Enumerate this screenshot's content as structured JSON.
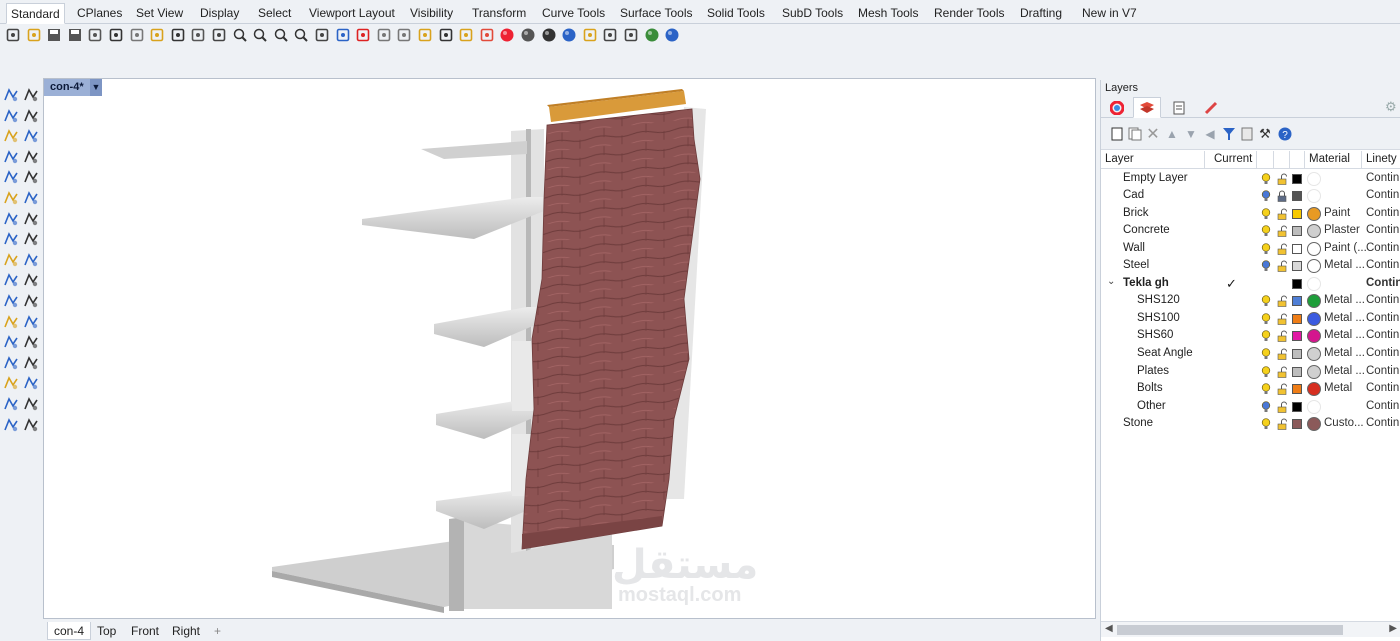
{
  "menu_tabs": [
    {
      "label": "Standard",
      "active": true
    },
    {
      "label": "CPlanes"
    },
    {
      "label": "Set View"
    },
    {
      "label": "Display"
    },
    {
      "label": "Select"
    },
    {
      "label": "Viewport Layout"
    },
    {
      "label": "Visibility"
    },
    {
      "label": "Transform"
    },
    {
      "label": "Curve Tools"
    },
    {
      "label": "Surface Tools"
    },
    {
      "label": "Solid Tools"
    },
    {
      "label": "SubD Tools"
    },
    {
      "label": "Mesh Tools"
    },
    {
      "label": "Render Tools"
    },
    {
      "label": "Drafting"
    },
    {
      "label": "New in V7"
    }
  ],
  "toolbar_icons": [
    "new-icon",
    "open-icon",
    "save-icon",
    "print-icon",
    "import-icon",
    "cut-icon",
    "copy-icon",
    "paste-icon",
    "undo-icon",
    "pan-icon",
    "move-view-icon",
    "zoom-icon",
    "zoom-window-icon",
    "zoom-extents-icon",
    "zoom-selected-icon",
    "rotate-view-icon",
    "viewport-layout-icon",
    "car-icon",
    "hide-icon",
    "select-icon",
    "show-icon",
    "light-icon",
    "lock-icon",
    "layer-icon",
    "color-icon",
    "shade-icon",
    "render-icon",
    "sphere-icon",
    "properties-icon",
    "options-icon",
    "grid-snap-icon",
    "globe-icon",
    "help-icon"
  ],
  "viewport": {
    "title": "con-4*",
    "tabs": [
      {
        "label": "con-4",
        "active": true
      },
      {
        "label": "Top"
      },
      {
        "label": "Front"
      },
      {
        "label": "Right"
      },
      {
        "label": "+"
      }
    ]
  },
  "watermark": {
    "arabic": "مستقل",
    "latin": "mostaql.com"
  },
  "layers_panel": {
    "title": "Layers",
    "columns": {
      "layer": "Layer",
      "current": "Current",
      "material": "Material",
      "linetype": "Linety"
    },
    "rows": [
      {
        "name": "Empty Layer",
        "indent": 0,
        "bulb": "#f5d11c",
        "lock": "open",
        "color": "#000000",
        "material": "",
        "mat_color": "",
        "linetype": "Contin"
      },
      {
        "name": "Cad",
        "indent": 0,
        "bulb": "#4a78d6",
        "lock": "closed",
        "color": "#555555",
        "material": "",
        "mat_color": "",
        "linetype": "Contin"
      },
      {
        "name": "Brick",
        "indent": 0,
        "bulb": "#f5d11c",
        "lock": "open",
        "color": "#f7c900",
        "material": "Paint",
        "mat_color": "#e89a23",
        "linetype": "Contin"
      },
      {
        "name": "Concrete",
        "indent": 0,
        "bulb": "#f5d11c",
        "lock": "open",
        "color": "#bdbdbd",
        "material": "Plaster",
        "mat_color": "#cfcfcf",
        "linetype": "Contin"
      },
      {
        "name": "Wall",
        "indent": 0,
        "bulb": "#f5d11c",
        "lock": "open",
        "color": "#ffffff",
        "material": "Paint (...",
        "mat_color": "#ffffff",
        "linetype": "Contin"
      },
      {
        "name": "Steel",
        "indent": 0,
        "bulb": "#4a78d6",
        "lock": "open",
        "color": "#d9d9d9",
        "material": "Metal ...",
        "mat_color": "#ffffff",
        "linetype": "Contin"
      },
      {
        "name": "Tekla gh",
        "indent": 0,
        "bold": true,
        "toggle": "⌄",
        "current": "✓",
        "color": "#000000",
        "material": "",
        "mat_color": "",
        "linetype": "Contin"
      },
      {
        "name": "SHS120",
        "indent": 1,
        "bulb": "#f5d11c",
        "lock": "open",
        "color": "#4f7fd6",
        "material": "Metal ...",
        "mat_color": "#1e9e3a",
        "linetype": "Contin"
      },
      {
        "name": "SHS100",
        "indent": 1,
        "bulb": "#f5d11c",
        "lock": "open",
        "color": "#ef7d16",
        "material": "Metal ...",
        "mat_color": "#3b5be0",
        "linetype": "Contin"
      },
      {
        "name": "SHS60",
        "indent": 1,
        "bulb": "#f5d11c",
        "lock": "open",
        "color": "#e11aa5",
        "material": "Metal ...",
        "mat_color": "#d4168e",
        "linetype": "Contin"
      },
      {
        "name": "Seat Angle",
        "indent": 1,
        "bulb": "#f5d11c",
        "lock": "open",
        "color": "#bdbdbd",
        "material": "Metal ...",
        "mat_color": "#d0d0d0",
        "linetype": "Contin"
      },
      {
        "name": "Plates",
        "indent": 1,
        "bulb": "#f5d11c",
        "lock": "open",
        "color": "#bdbdbd",
        "material": "Metal ...",
        "mat_color": "#d0d0d0",
        "linetype": "Contin"
      },
      {
        "name": "Bolts",
        "indent": 1,
        "bulb": "#f5d11c",
        "lock": "open",
        "color": "#ef7d16",
        "material": "Metal",
        "mat_color": "#d62e20",
        "linetype": "Contin"
      },
      {
        "name": "Other",
        "indent": 1,
        "bulb": "#4a78d6",
        "lock": "open",
        "color": "#000000",
        "material": "",
        "mat_color": "",
        "linetype": "Contin"
      },
      {
        "name": "Stone",
        "indent": 0,
        "bulb": "#f5d11c",
        "lock": "open",
        "color": "#8b5a5a",
        "material": "Custo...",
        "mat_color": "#8b5a5a",
        "linetype": "Contin"
      }
    ]
  },
  "colors": {
    "accent": "#9bb0d6",
    "brick": "#8b5050",
    "timber": "#d99a3a",
    "steel": "#dcdcdc"
  }
}
